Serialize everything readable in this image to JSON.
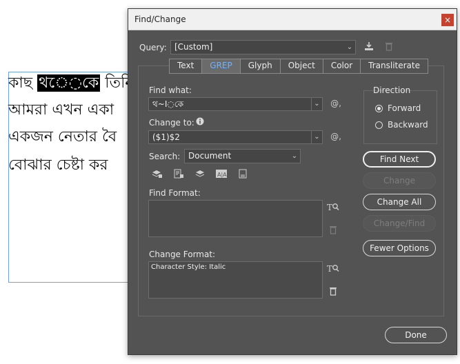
{
  "document": {
    "lines": [
      {
        "before": "কাছ ",
        "selected": "থ◌ে◌কে",
        "after": " তিনি"
      },
      {
        "before": "আমরা এখন একা",
        "selected": "",
        "after": ""
      },
      {
        "before": "একজন নেতার বৈ",
        "selected": "",
        "after": ""
      },
      {
        "before": "বোঝার চেষ্টা কর",
        "selected": "",
        "after": ""
      }
    ]
  },
  "dialog": {
    "title": "Find/Change",
    "close_label": "×",
    "query": {
      "label": "Query:",
      "value": "[Custom]"
    },
    "tabs": [
      {
        "label": "Text",
        "active": false
      },
      {
        "label": "GREP",
        "active": true
      },
      {
        "label": "Glyph",
        "active": false
      },
      {
        "label": "Object",
        "active": false
      },
      {
        "label": "Color",
        "active": false
      },
      {
        "label": "Transliterate",
        "active": false
      }
    ],
    "find_what": {
      "label": "Find what:",
      "value": "থ~I◌কে"
    },
    "change_to": {
      "label": "Change to:",
      "value": "($1)$2"
    },
    "search": {
      "label": "Search:",
      "value": "Document"
    },
    "find_format": {
      "label": "Find Format:",
      "value": ""
    },
    "change_format": {
      "label": "Change Format:",
      "value": "Character Style: Italic"
    },
    "direction": {
      "label": "Direction",
      "options": [
        {
          "label": "Forward",
          "checked": true
        },
        {
          "label": "Backward",
          "checked": false
        }
      ]
    },
    "buttons": {
      "find_next": "Find Next",
      "change": "Change",
      "change_all": "Change All",
      "change_find": "Change/Find",
      "fewer_options": "Fewer Options",
      "done": "Done"
    },
    "special_char_glyph": "@,"
  },
  "colors": {
    "dialog_bg": "#535353",
    "active_tab_text": "#6fb3ff",
    "close_button": "#c7412f"
  }
}
